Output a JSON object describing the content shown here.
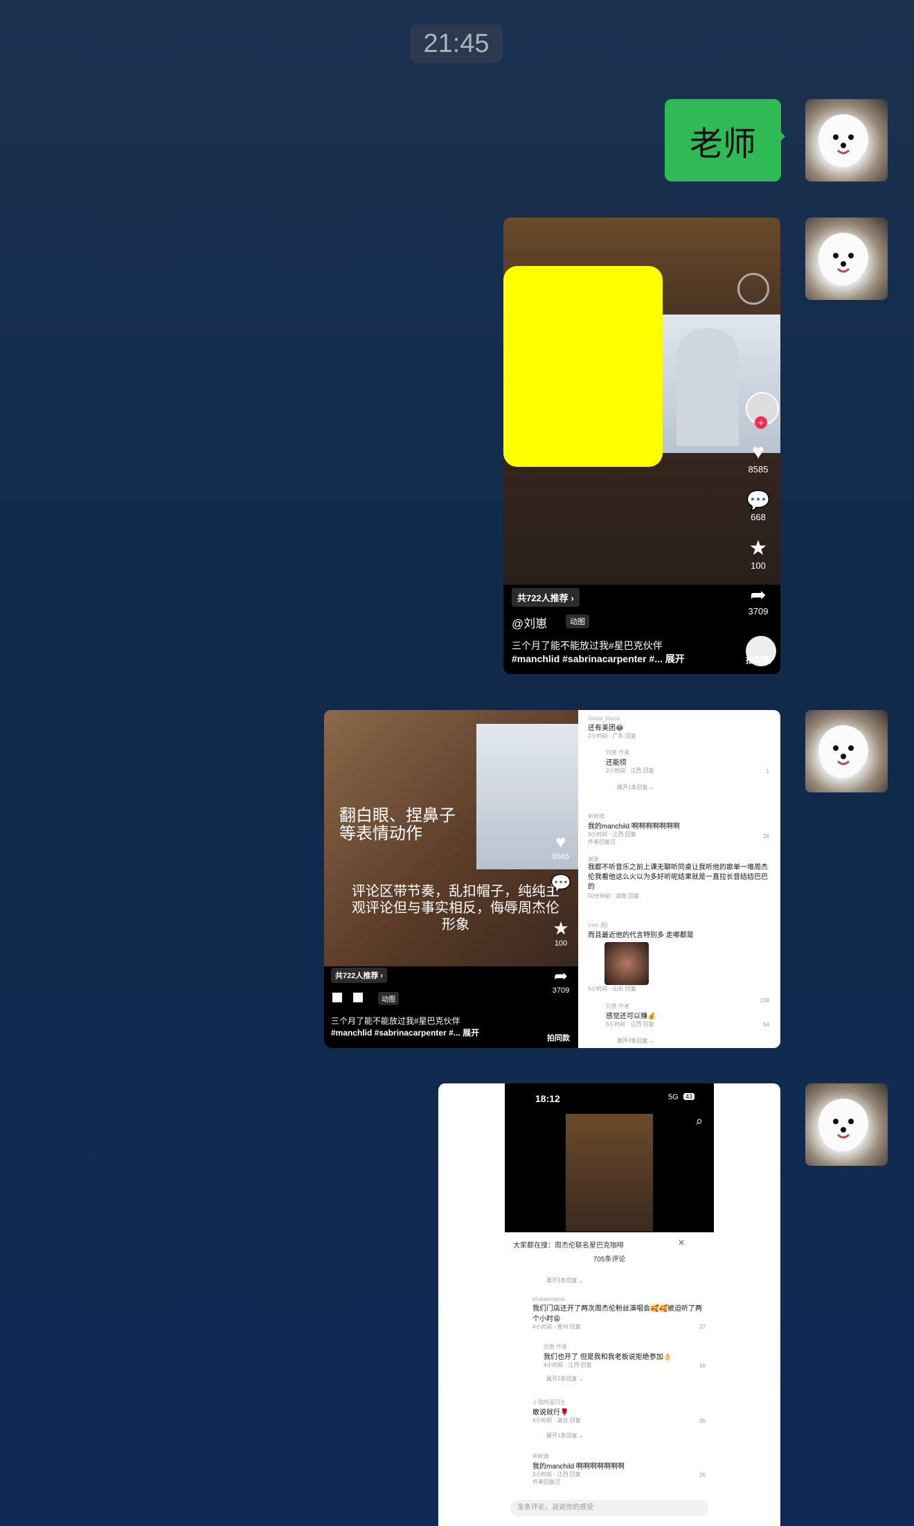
{
  "time": "21:45",
  "message_text": "老师",
  "video1": {
    "likes": "8585",
    "comments": "668",
    "favorites": "100",
    "shares": "3709",
    "recommend": "共722人推荐",
    "author": "@刘崽",
    "badge": "动图",
    "caption_line1": "三个月了能不能放过我#星巴克伙伴",
    "caption_line2": "#manchlid #sabrinacarpenter #... 展开",
    "shoot_label": "拍同款"
  },
  "card2": {
    "overlay1_line1": "翻白眼、捏鼻子",
    "overlay1_line2": "等表情动作",
    "overlay2_line1": "评论区带节奏，乱扣帽子，纯纯主",
    "overlay2_line2": "观评论但与事实相反，侮辱周杰伦",
    "overlay2_line3": "形象",
    "likes": "8585",
    "favorites": "100",
    "shares": "3709",
    "recommend": "共722人推荐",
    "badge": "动图",
    "caption_line1": "三个月了能不能放过我#星巴克伙伴",
    "caption_line2": "#manchlid #sabrinacarpenter #... 展开",
    "shoot_label": "拍同款",
    "comments": [
      {
        "user": "Gloria_Mood",
        "text": "还有美团😂",
        "meta": "2小时前 · 广东  回复",
        "likes": ""
      },
      {
        "user": "刘崽 作者",
        "text": "还能捞",
        "meta": "2小时前 · 江西  回复",
        "likes": "1"
      },
      {
        "user": "",
        "text": "展开1条回复 ⌄",
        "meta": "",
        "likes": ""
      },
      {
        "user": "新鲜摘",
        "text": "我的manchild 啊啊啊啊啊啊啊",
        "meta": "3小时前 · 江西  回复",
        "likes": "26"
      },
      {
        "user": "",
        "text": "作者回复过",
        "meta": "",
        "likes": ""
      },
      {
        "user": "谢谢",
        "text": "我都不听音乐之前上课无聊听同桌让我听他的歌单一堆周杰伦我看他这么火以为多好听呢结果就是一直拉长音结结巴巴的",
        "meta": "50分钟前 · 湖南  回复",
        "likes": ""
      },
      {
        "user": "(non 图)",
        "text": "而且最近他的代言特别多 走哪都是",
        "meta": "5小时前 · 山东  回复",
        "likes": "108"
      },
      {
        "user": "刘崽 作者",
        "text": "感觉还可以赚💰",
        "meta": "5小时前 · 江西  回复",
        "likes": "54"
      },
      {
        "user": "",
        "text": "展开4条回复 ⌄",
        "meta": "",
        "likes": ""
      }
    ]
  },
  "card3": {
    "status_time": "18:12",
    "status_right": "5G",
    "battery": "43",
    "search_hint": "大家都在搜：周杰伦联名星巴克咖啡",
    "comment_count": "705条评论",
    "expand_top": "展开3条回复 ⌄",
    "comments": [
      {
        "user": "phalaenopsis",
        "text": "我们门店还开了两次周杰伦粉丝演唱会🥰🥰被迫听了两个小时😩",
        "meta": "4小时前 · 贵州  回复",
        "likes": "27"
      },
      {
        "user": "刘崽 作者",
        "text": "我们也开了 但是我和我老板说拒绝参加👌",
        "meta": "4小时前 · 江西  回复",
        "likes": "16"
      },
      {
        "user": "",
        "text": "展开2条回复 ⌄",
        "meta": "",
        "likes": ""
      },
      {
        "user": "小猫咪蛋日生",
        "text": "敢说就行🌹",
        "meta": "4小时前 · 湖北  回复",
        "likes": "35"
      },
      {
        "user": "",
        "text": "展开1条回复 ⌄",
        "meta": "",
        "likes": ""
      },
      {
        "user": "新鲜摘",
        "text": "我的manchild 啊啊啊啊啊啊啊",
        "meta": "3小时前 · 江西  回复",
        "likes": "26"
      },
      {
        "user": "",
        "text": "作者回复过",
        "meta": "",
        "likes": ""
      }
    ],
    "input_placeholder": "发条评论，说说你的感受"
  }
}
